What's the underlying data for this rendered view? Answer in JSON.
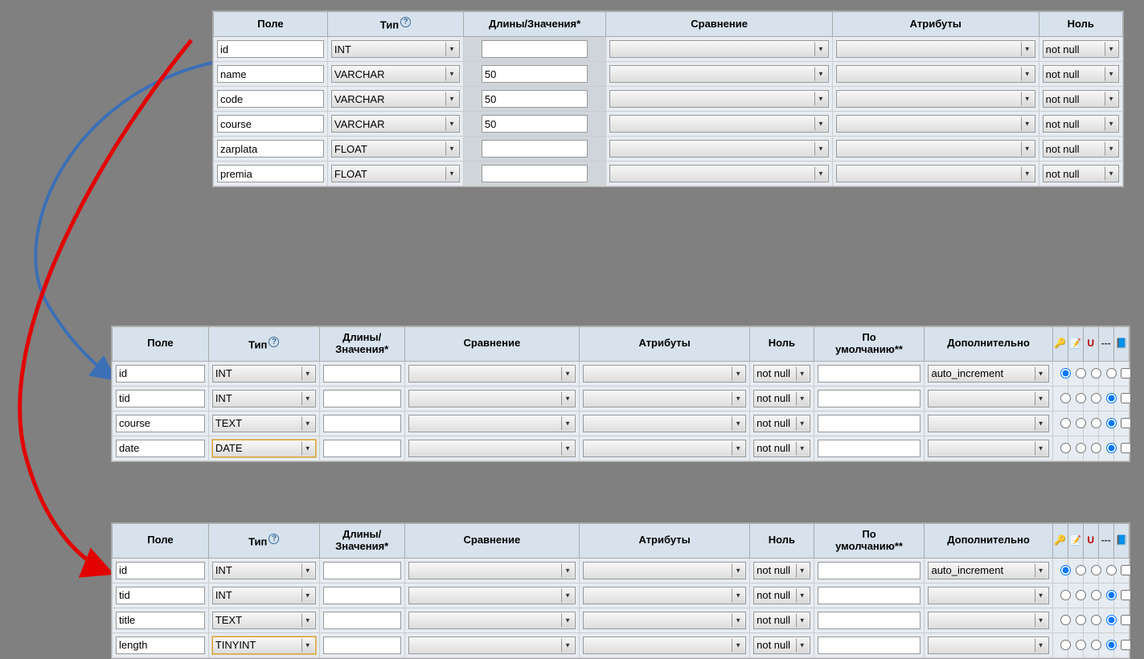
{
  "headers": {
    "field": "Поле",
    "type": "Тип",
    "length": "Длины/Значения*",
    "length2a": "Длины/",
    "length2b": "Значения*",
    "collation": "Сравнение",
    "attributes": "Атрибуты",
    "null": "Ноль",
    "default2a": "По",
    "default2b": "умолчанию**",
    "extra": "Дополнительно"
  },
  "null_value": "not null",
  "extra_auto": "auto_increment",
  "panel1": {
    "rows": [
      {
        "field": "id",
        "type": "INT",
        "len": ""
      },
      {
        "field": "name",
        "type": "VARCHAR",
        "len": "50"
      },
      {
        "field": "code",
        "type": "VARCHAR",
        "len": "50"
      },
      {
        "field": "course",
        "type": "VARCHAR",
        "len": "50"
      },
      {
        "field": "zarplata",
        "type": "FLOAT",
        "len": ""
      },
      {
        "field": "premia",
        "type": "FLOAT",
        "len": ""
      }
    ]
  },
  "panel2": {
    "rows": [
      {
        "field": "id",
        "type": "INT",
        "extra": "auto_increment",
        "radio_index": 0,
        "hl": false
      },
      {
        "field": "tid",
        "type": "INT",
        "extra": "",
        "radio_index": 3,
        "hl": false
      },
      {
        "field": "course",
        "type": "TEXT",
        "extra": "",
        "radio_index": 3,
        "hl": false
      },
      {
        "field": "date",
        "type": "DATE",
        "extra": "",
        "radio_index": 3,
        "hl": true
      }
    ]
  },
  "panel3": {
    "rows": [
      {
        "field": "id",
        "type": "INT",
        "extra": "auto_increment",
        "radio_index": 0,
        "hl": false
      },
      {
        "field": "tid",
        "type": "INT",
        "extra": "",
        "radio_index": 3,
        "hl": false
      },
      {
        "field": "title",
        "type": "TEXT",
        "extra": "",
        "radio_index": 3,
        "hl": false
      },
      {
        "field": "length",
        "type": "TINYINT",
        "extra": "",
        "radio_index": 3,
        "hl": true
      }
    ]
  }
}
